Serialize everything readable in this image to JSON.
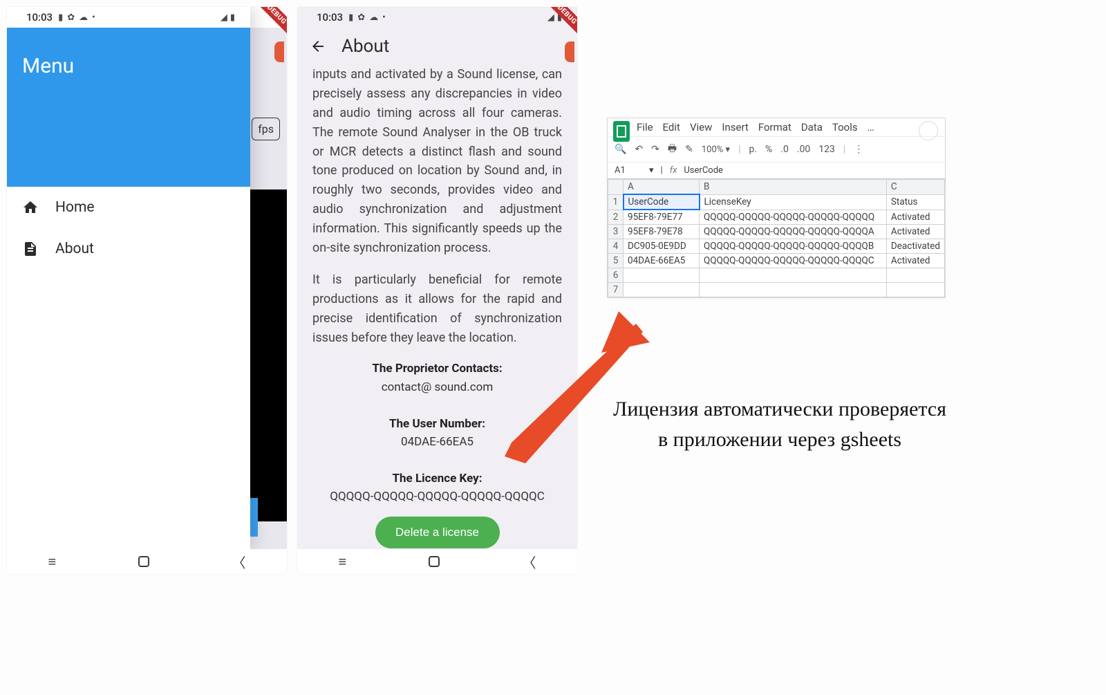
{
  "statusbar": {
    "time": "10:03"
  },
  "debug_ribbon": "DEBUG",
  "drawer": {
    "title": "Menu",
    "items": [
      {
        "icon": "home-icon",
        "label": "Home"
      },
      {
        "icon": "about-icon",
        "label": "About"
      }
    ]
  },
  "peek": {
    "fps_label": "fps"
  },
  "about": {
    "title": "About",
    "para1": "inputs and activated by a  Sound license, can precisely assess any discrepancies in video and audio timing across all four cameras. The remote  Sound Analyser in the OB truck or MCR detects a distinct flash and sound tone produced on location by  Sound and, in roughly two seconds, provides video and audio synchronization and adjustment information. This significantly speeds up the on-site synchronization process.",
    "para2": "It is particularly beneficial for remote productions as it allows for the rapid and precise identification of synchronization issues before they leave the location.",
    "contacts_label": "The Proprietor Contacts:",
    "contacts_value": "contact@    sound.com",
    "usernum_label": "The User Number:",
    "usernum_value": "04DAE-66EA5",
    "licence_label": "The Licence Key:",
    "licence_value": "QQQQQ-QQQQQ-QQQQQ-QQQQQ-QQQQC",
    "delete_btn": "Delete a license"
  },
  "sheets": {
    "menus": [
      "File",
      "Edit",
      "View",
      "Insert",
      "Format",
      "Data",
      "Tools",
      "…"
    ],
    "toolbar": {
      "zoom": "100% ▾",
      "items": [
        "p.",
        "%",
        ".0",
        ".00",
        "123"
      ]
    },
    "namebox": {
      "cell": "A1",
      "formula": "UserCode"
    },
    "columns": [
      "A",
      "B",
      "C"
    ],
    "headers": [
      "UserCode",
      "LicenseKey",
      "Status"
    ],
    "rows": [
      {
        "n": "2",
        "a": "95EF8-79E77",
        "b": "QQQQQ-QQQQQ-QQQQQ-QQQQQ-QQQQQ",
        "c": "Activated"
      },
      {
        "n": "3",
        "a": "95EF8-79E78",
        "b": "QQQQQ-QQQQQ-QQQQQ-QQQQQ-QQQQA",
        "c": "Activated"
      },
      {
        "n": "4",
        "a": "DC905-0E9DD",
        "b": "QQQQQ-QQQQQ-QQQQQ-QQQQQ-QQQQB",
        "c": "Deactivated"
      },
      {
        "n": "5",
        "a": "04DAE-66EA5",
        "b": "QQQQQ-QQQQQ-QQQQQ-QQQQQ-QQQQC",
        "c": "Activated"
      },
      {
        "n": "6",
        "a": "",
        "b": "",
        "c": ""
      },
      {
        "n": "7",
        "a": "",
        "b": "",
        "c": ""
      }
    ]
  },
  "caption": "Лицензия автоматически проверяется в приложении через gsheets"
}
